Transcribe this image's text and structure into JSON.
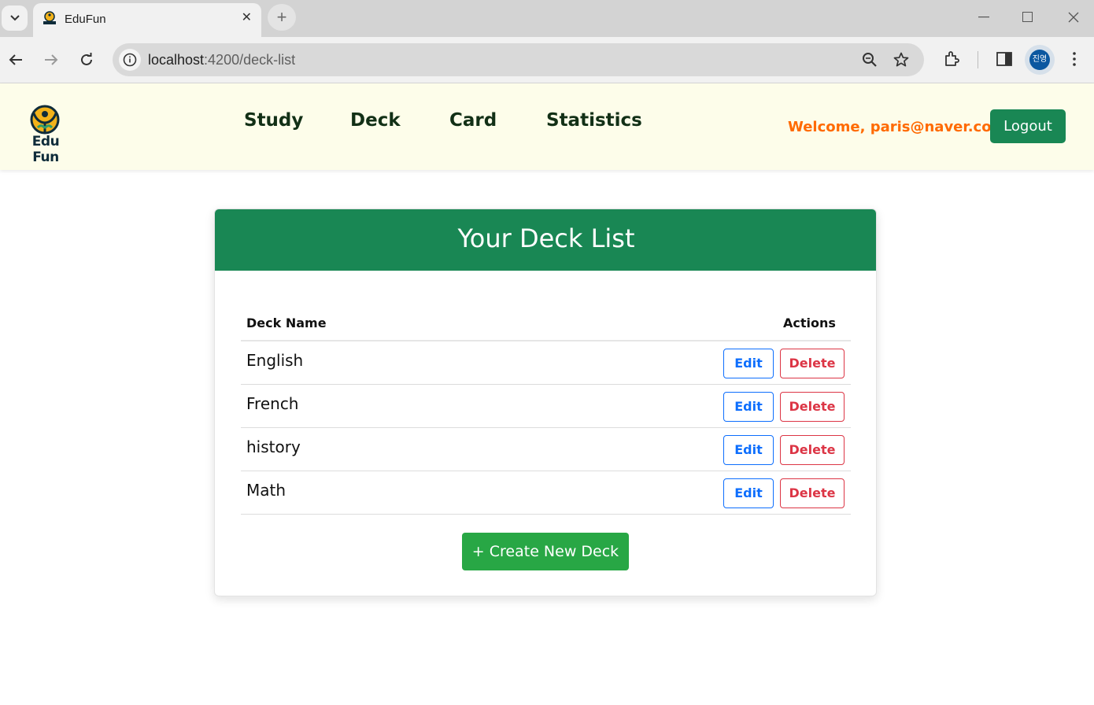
{
  "browser": {
    "tab_title": "EduFun",
    "url_host": "localhost",
    "url_path": ":4200/deck-list",
    "profile_initials": "진영"
  },
  "header": {
    "logo_text": "Edu Fun",
    "nav": [
      "Study",
      "Deck",
      "Card",
      "Statistics"
    ],
    "welcome": "Welcome,  paris@naver.com!",
    "logout_label": "Logout"
  },
  "card": {
    "title": "Your Deck List",
    "col_name": "Deck Name",
    "col_actions": "Actions",
    "decks": [
      {
        "name": "English"
      },
      {
        "name": "French"
      },
      {
        "name": "history"
      },
      {
        "name": "Math"
      }
    ],
    "edit_label": "Edit",
    "delete_label": "Delete",
    "create_label": "+ Create New Deck"
  },
  "colors": {
    "brand_green": "#198754",
    "create_green": "#28a745",
    "header_bg": "#fdfdea",
    "welcome_orange": "#ff6a00",
    "edit_blue": "#0d6efd",
    "delete_red": "#dc3545"
  }
}
